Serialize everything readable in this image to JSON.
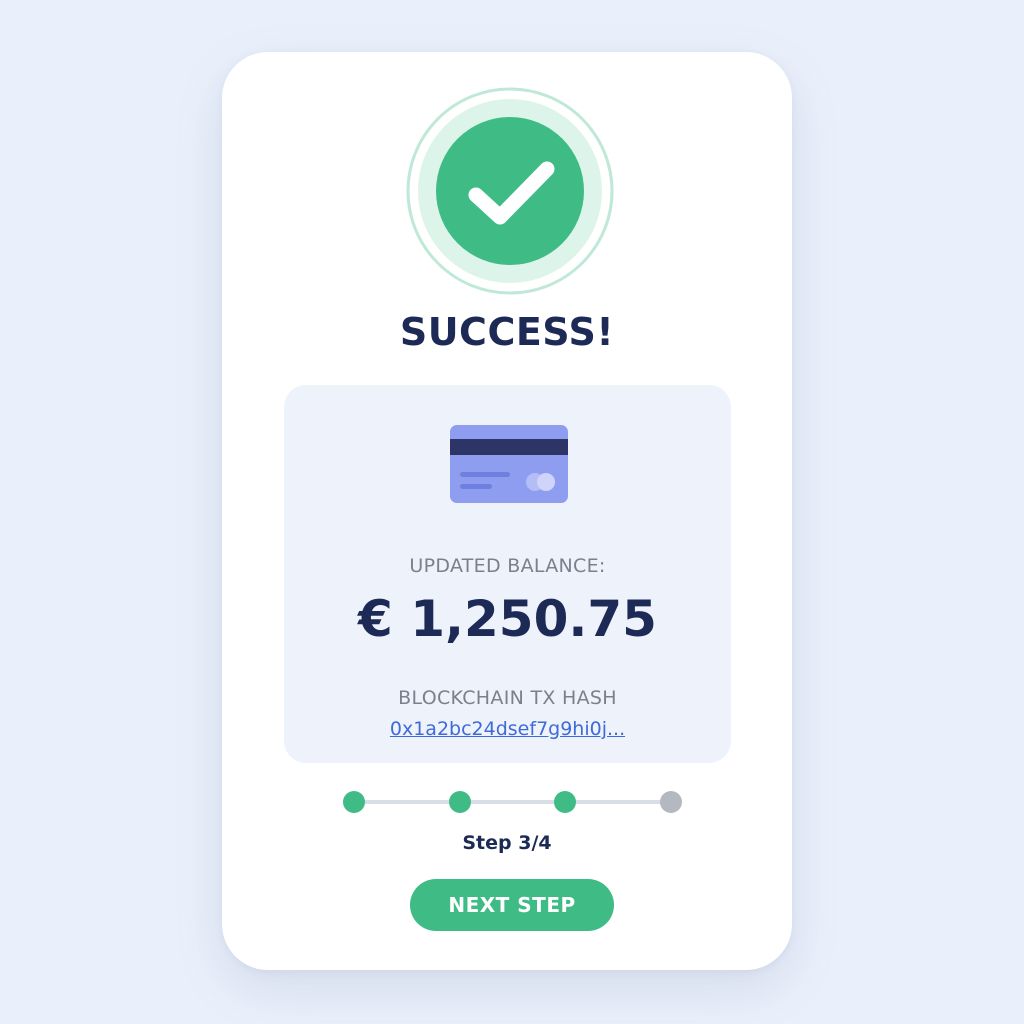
{
  "status": {
    "title": "SUCCESS!",
    "icon": "check-circle-icon",
    "accent_color": "#3fbc86"
  },
  "balance": {
    "icon": "credit-card-icon",
    "label": "UPDATED BALANCE:",
    "amount": "€ 1,250.75"
  },
  "transaction": {
    "label": "BLOCKCHAIN TX HASH",
    "hash": "0x1a2bc24dsef7g9hi0j..."
  },
  "progress": {
    "steps_total": 4,
    "steps_completed": 3,
    "label": "Step 3/4",
    "complete_color": "#3fbc86",
    "pending_color": "#b3b8c1"
  },
  "actions": {
    "next_label": "NEXT STEP"
  }
}
